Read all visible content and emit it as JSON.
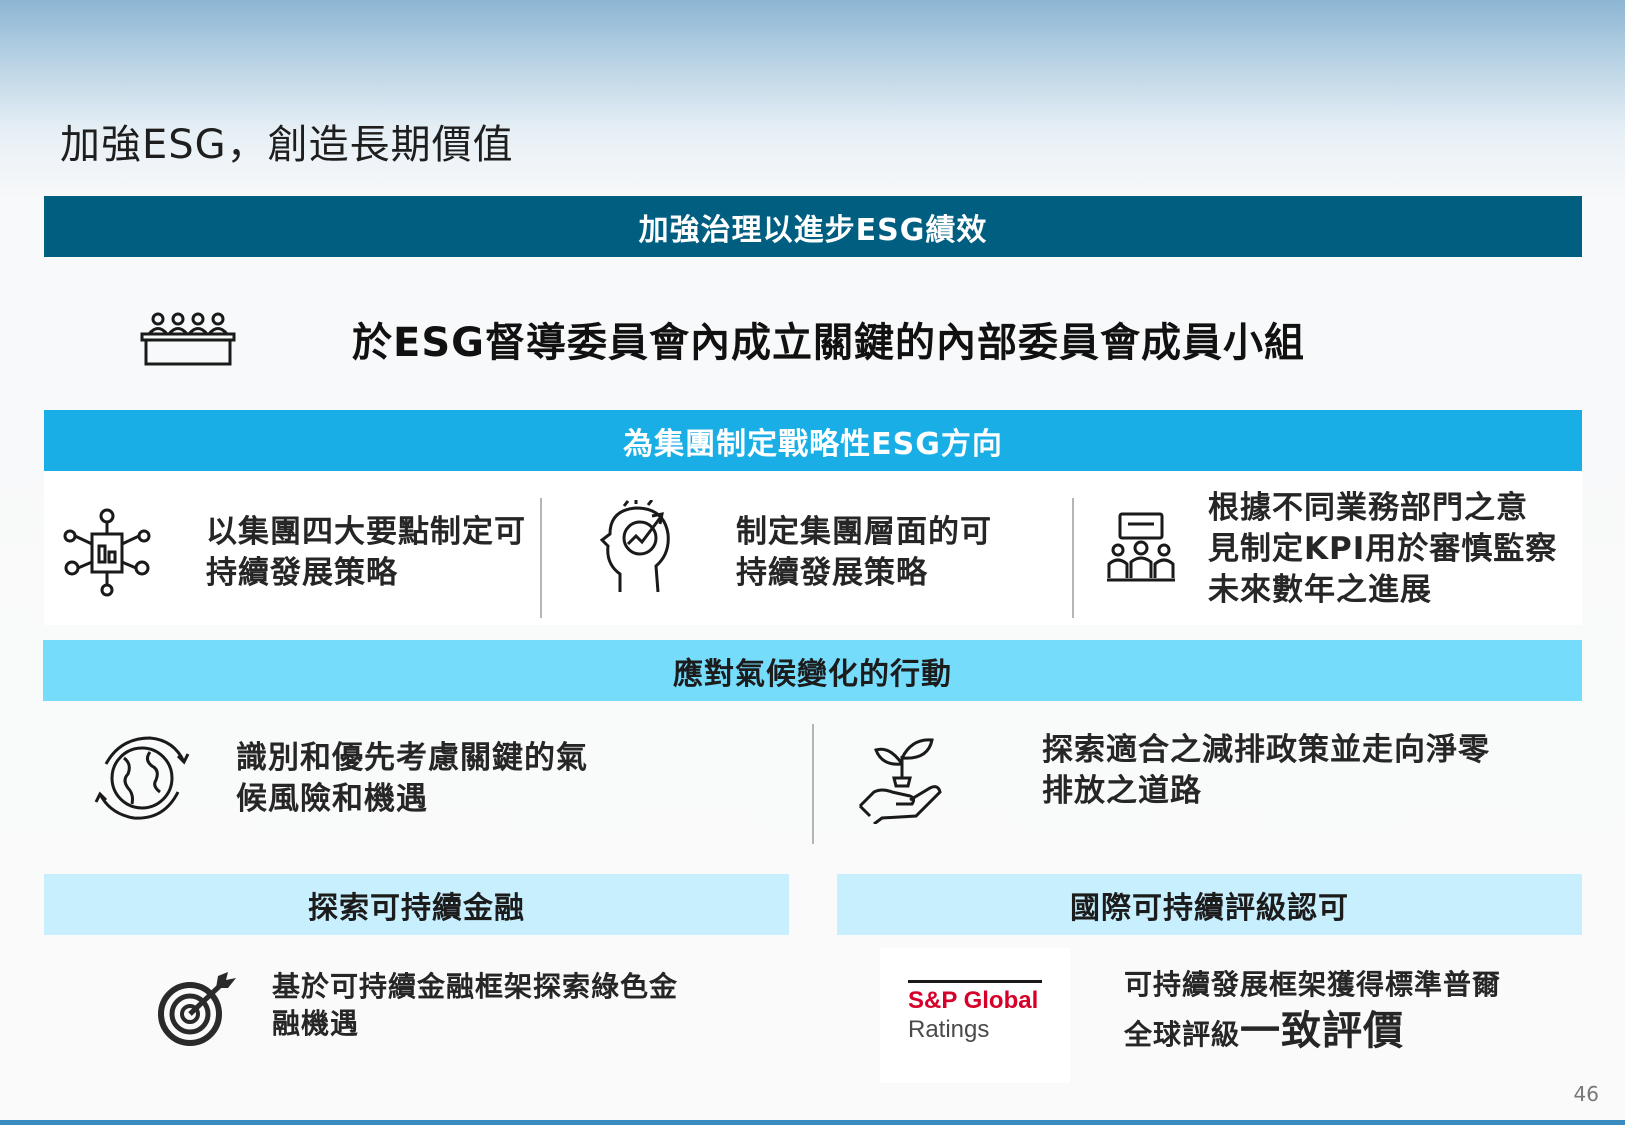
{
  "page": {
    "title": "加強ESG，創造長期價值",
    "page_number": "46"
  },
  "governance": {
    "banner": "加強治理以進步ESG績效",
    "headline": "於ESG督導委員會內成立關鍵的內部委員會成員小組",
    "icon": "board-meeting-icon"
  },
  "strategy": {
    "banner": "為集團制定戰略性ESG方向",
    "items": [
      {
        "icon": "network-hub-icon",
        "text_line1": "以集團四大要點制定可",
        "text_line2": "持續發展策略",
        "text_line3": ""
      },
      {
        "icon": "head-growth-icon",
        "text_line1": "制定集團層面的可",
        "text_line2": "持續發展策略",
        "text_line3": ""
      },
      {
        "icon": "team-presentation-icon",
        "text_line1": "根據不同業務部門之意",
        "text_line2": "見制定KPI用於審慎監察",
        "text_line3": "未來數年之進展"
      }
    ]
  },
  "climate": {
    "banner": "應對氣候變化的行動",
    "items": [
      {
        "icon": "globe-cycle-icon",
        "text_line1": "識別和優先考慮關鍵的氣",
        "text_line2": "候風險和機遇"
      },
      {
        "icon": "hand-sprout-icon",
        "text_line1": "探索適合之減排政策並走向淨零",
        "text_line2": "排放之道路"
      }
    ]
  },
  "finance": {
    "banner": "探索可持續金融",
    "icon": "target-arrow-icon",
    "text_line1": "基於可持續金融框架探索綠色金",
    "text_line2": "融機遇"
  },
  "rating": {
    "banner": "國際可持續評級認可",
    "logo_line1": "S&P Global",
    "logo_line2": "Ratings",
    "text_line1": "可持續發展框架獲得標準普爾",
    "text_line2_small": "全球評級",
    "text_line2_large": "一致評價"
  },
  "colors": {
    "dark_banner": "#005e80",
    "mid_banner": "#1aaee6",
    "light_banner": "#75dcfb",
    "pale_banner": "#c8effd",
    "sp_red": "#d6002a"
  }
}
